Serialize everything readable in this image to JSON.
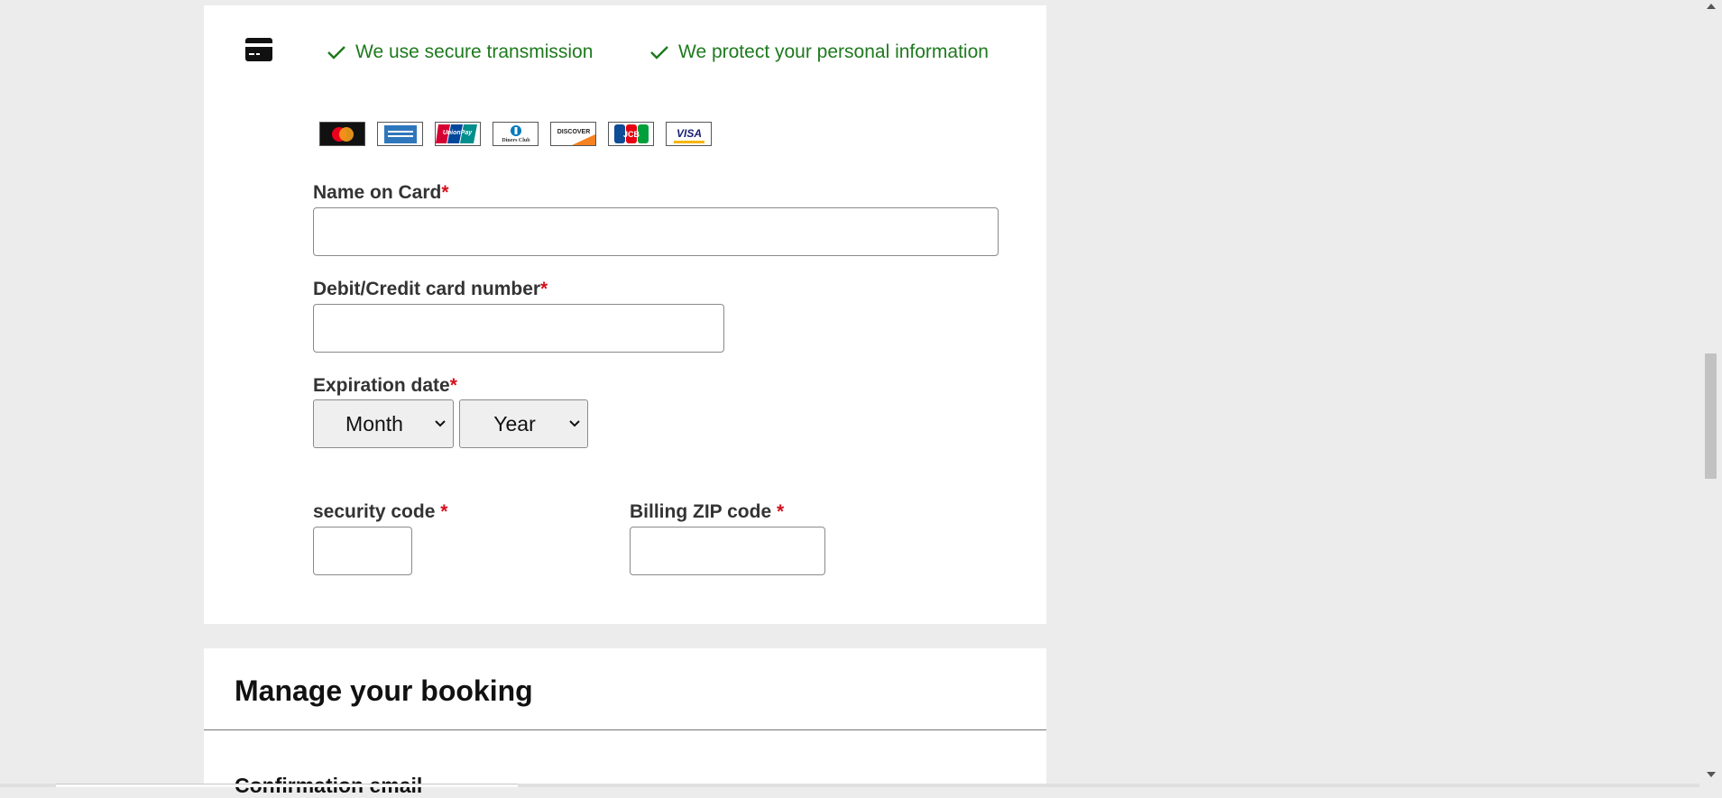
{
  "payment": {
    "trust_1": "We use secure transmission",
    "trust_2": "We protect your personal information",
    "accent_color": "#1e7a1e",
    "required_color": "#d4111e",
    "card_logos": [
      "mastercard",
      "american-express",
      "unionpay",
      "diners-club",
      "discover",
      "jcb",
      "visa"
    ],
    "logo_text": {
      "unionpay": "UnionPay",
      "diners": "Diners Club",
      "discover": "DISCOVER",
      "jcb": "JCB",
      "visa": "VISA"
    },
    "name_label": "Name on Card",
    "number_label": "Debit/Credit card number",
    "expiry_label": "Expiration date",
    "month_value": "Month",
    "year_value": "Year",
    "security_label": "security code",
    "zip_label": "Billing ZIP code",
    "required_mark": "*",
    "name_value": "",
    "number_value": "",
    "security_value": "",
    "zip_value": ""
  },
  "manage": {
    "title": "Manage your booking",
    "confirmation_label": "Confirmation email"
  }
}
